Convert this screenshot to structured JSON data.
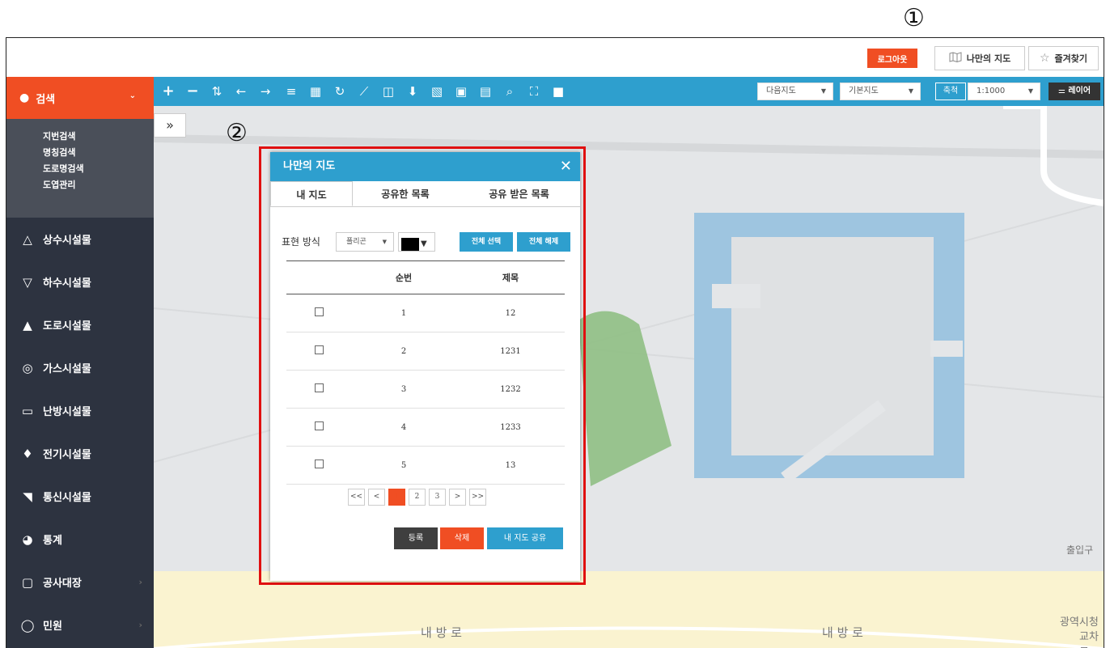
{
  "markers": {
    "one": "①",
    "two": "②"
  },
  "header": {
    "logout_label": "로그아웃",
    "mymap_label": "나만의 지도",
    "favorites_label": "즐겨찾기"
  },
  "sidebar": {
    "search_label": "검색",
    "sub_items": [
      "지번검색",
      "명칭검색",
      "도로명검색",
      "도엽관리"
    ],
    "items": [
      {
        "label": "상수시설물",
        "icon": "triangle-up-icon"
      },
      {
        "label": "하수시설물",
        "icon": "triangle-down-icon"
      },
      {
        "label": "도로시설물",
        "icon": "road-icon"
      },
      {
        "label": "가스시설물",
        "icon": "gas-icon"
      },
      {
        "label": "난방시설물",
        "icon": "heating-icon"
      },
      {
        "label": "전기시설물",
        "icon": "electric-icon"
      },
      {
        "label": "통신시설물",
        "icon": "signal-icon"
      },
      {
        "label": "통계",
        "icon": "pie-chart-icon"
      },
      {
        "label": "공사대장",
        "icon": "document-search-icon"
      },
      {
        "label": "민원",
        "icon": "phone-icon"
      }
    ]
  },
  "toolbar": {
    "map_source": "다음지도",
    "map_type": "기본지도",
    "scale_label": "축척",
    "scale_value": "1:1000",
    "layer_label": "레이어"
  },
  "map": {
    "road_label_1": "내 방 로",
    "road_label_2": "내 방 로",
    "entrance_label": "출입구",
    "building_label_1": "광역시청",
    "building_label_2": "교차로"
  },
  "dialog": {
    "title": "나만의 지도",
    "tabs": [
      "내 지도",
      "공유한 목록",
      "공유 받은 목록"
    ],
    "display_label": "표현 방식",
    "display_type": "폴리곤",
    "select_all": "전체 선택",
    "deselect_all": "전체 해제",
    "columns": [
      "순번",
      "제목"
    ],
    "rows": [
      {
        "num": "1",
        "title": "12"
      },
      {
        "num": "2",
        "title": "1231"
      },
      {
        "num": "3",
        "title": "1232"
      },
      {
        "num": "4",
        "title": "1233"
      },
      {
        "num": "5",
        "title": "13"
      }
    ],
    "pager": [
      "<<",
      "<",
      "1",
      "2",
      "3",
      ">",
      ">>"
    ],
    "btn_register": "등록",
    "btn_delete": "삭제",
    "btn_share": "내 지도 공유"
  },
  "colors": {
    "accent_orange": "#f04e23",
    "accent_blue": "#2e9fce",
    "sidebar_bg": "#2d3340"
  }
}
